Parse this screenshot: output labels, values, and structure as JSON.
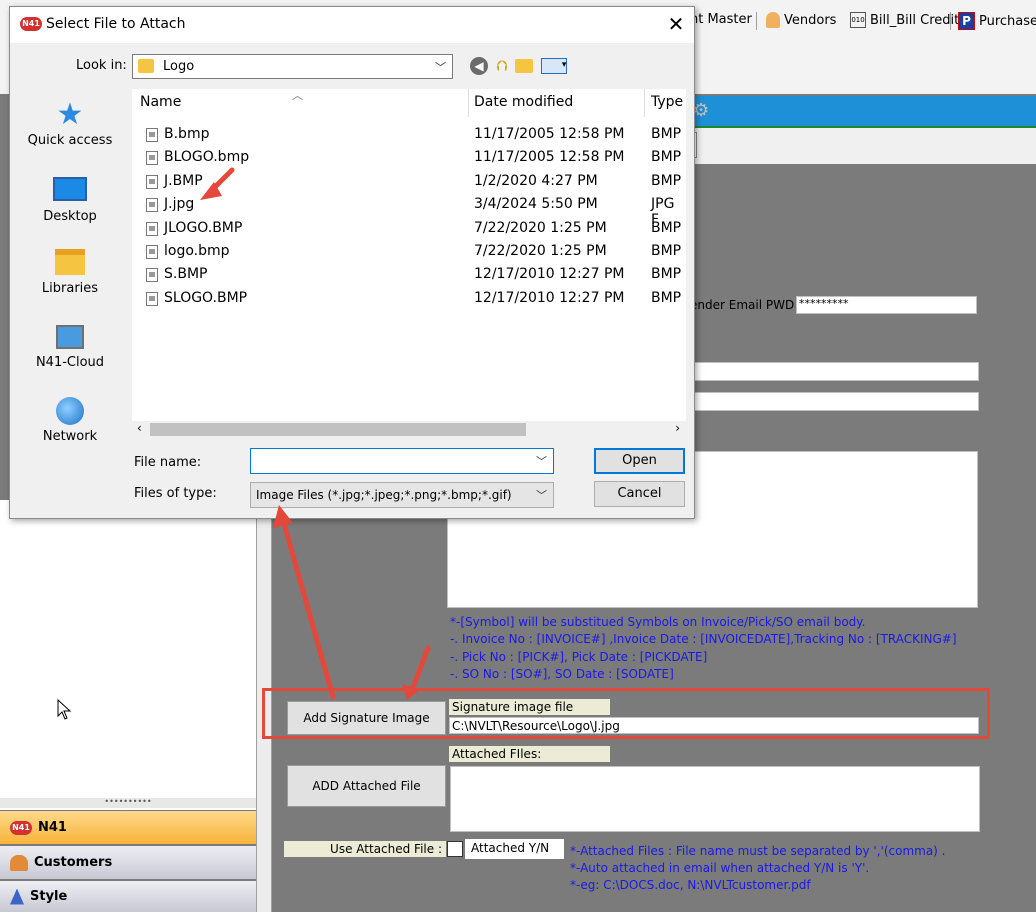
{
  "toolbar": {
    "items": [
      "nt Master",
      "Vendors",
      "Bill_Bill Credit",
      "Purchase"
    ]
  },
  "sidebar": {
    "items": [
      {
        "label": "N41",
        "icon": "n41-logo-icon"
      },
      {
        "label": "Customers",
        "icon": "customers-icon"
      },
      {
        "label": "Style",
        "icon": "style-icon"
      }
    ]
  },
  "form": {
    "sender_pwd_label": "ender Email PWD :",
    "sender_pwd_value": "*********",
    "notes": [
      "*-[Symbol] will be substitued Symbols on Invoice/Pick/SO email body.",
      "-. Invoice No : [INVOICE#] ,Invoice Date : [INVOICEDATE],Tracking No : [TRACKING#]",
      "-. Pick No : [PICK#], Pick Date : [PICKDATE]",
      "-. SO No : [SO#], SO Date : [SODATE]"
    ],
    "add_signature_button": "Add Signature Image",
    "signature_label": "Signature image file",
    "signature_value": "C:\\NVLT\\Resource\\Logo\\J.jpg",
    "add_attached_button": "ADD Attached File",
    "attached_label": "Attached FIles:",
    "use_attached_label": "Use Attached File :",
    "attached_yn_label": "Attached Y/N",
    "attached_notes": [
      "*-Attached Files : File name must be separated by ','(comma) .",
      "*-Auto attached in email when attached Y/N is 'Y'.",
      "*-eg: C:\\DOCS.doc, N:\\NVLTcustomer.pdf"
    ]
  },
  "dialog": {
    "title": "Select File to Attach",
    "look_in_label": "Look in:",
    "look_in_value": "Logo",
    "places": [
      "Quick access",
      "Desktop",
      "Libraries",
      "N41-Cloud",
      "Network"
    ],
    "columns": {
      "name": "Name",
      "date": "Date modified",
      "type": "Type"
    },
    "files": [
      {
        "name": "B.bmp",
        "date": "11/17/2005 12:58 PM",
        "type": "BMP"
      },
      {
        "name": "BLOGO.bmp",
        "date": "11/17/2005 12:58 PM",
        "type": "BMP"
      },
      {
        "name": "J.BMP",
        "date": "1/2/2020 4:27 PM",
        "type": "BMP"
      },
      {
        "name": "J.jpg",
        "date": "3/4/2024 5:50 PM",
        "type": "JPG F"
      },
      {
        "name": "JLOGO.BMP",
        "date": "7/22/2020 1:25 PM",
        "type": "BMP"
      },
      {
        "name": "logo.bmp",
        "date": "7/22/2020 1:25 PM",
        "type": "BMP"
      },
      {
        "name": "S.BMP",
        "date": "12/17/2010 12:27 PM",
        "type": "BMP"
      },
      {
        "name": "SLOGO.BMP",
        "date": "12/17/2010 12:27 PM",
        "type": "BMP"
      }
    ],
    "file_name_label": "File name:",
    "file_name_value": "",
    "file_type_label": "Files of type:",
    "file_type_value": "Image Files (*.jpg;*.jpeg;*.png;*.bmp;*.gif)",
    "open_button": "Open",
    "cancel_button": "Cancel"
  },
  "colors": {
    "accent_blue": "#1e90d8",
    "annotation_red": "#e3483b",
    "note_blue": "#1a1ae6"
  }
}
